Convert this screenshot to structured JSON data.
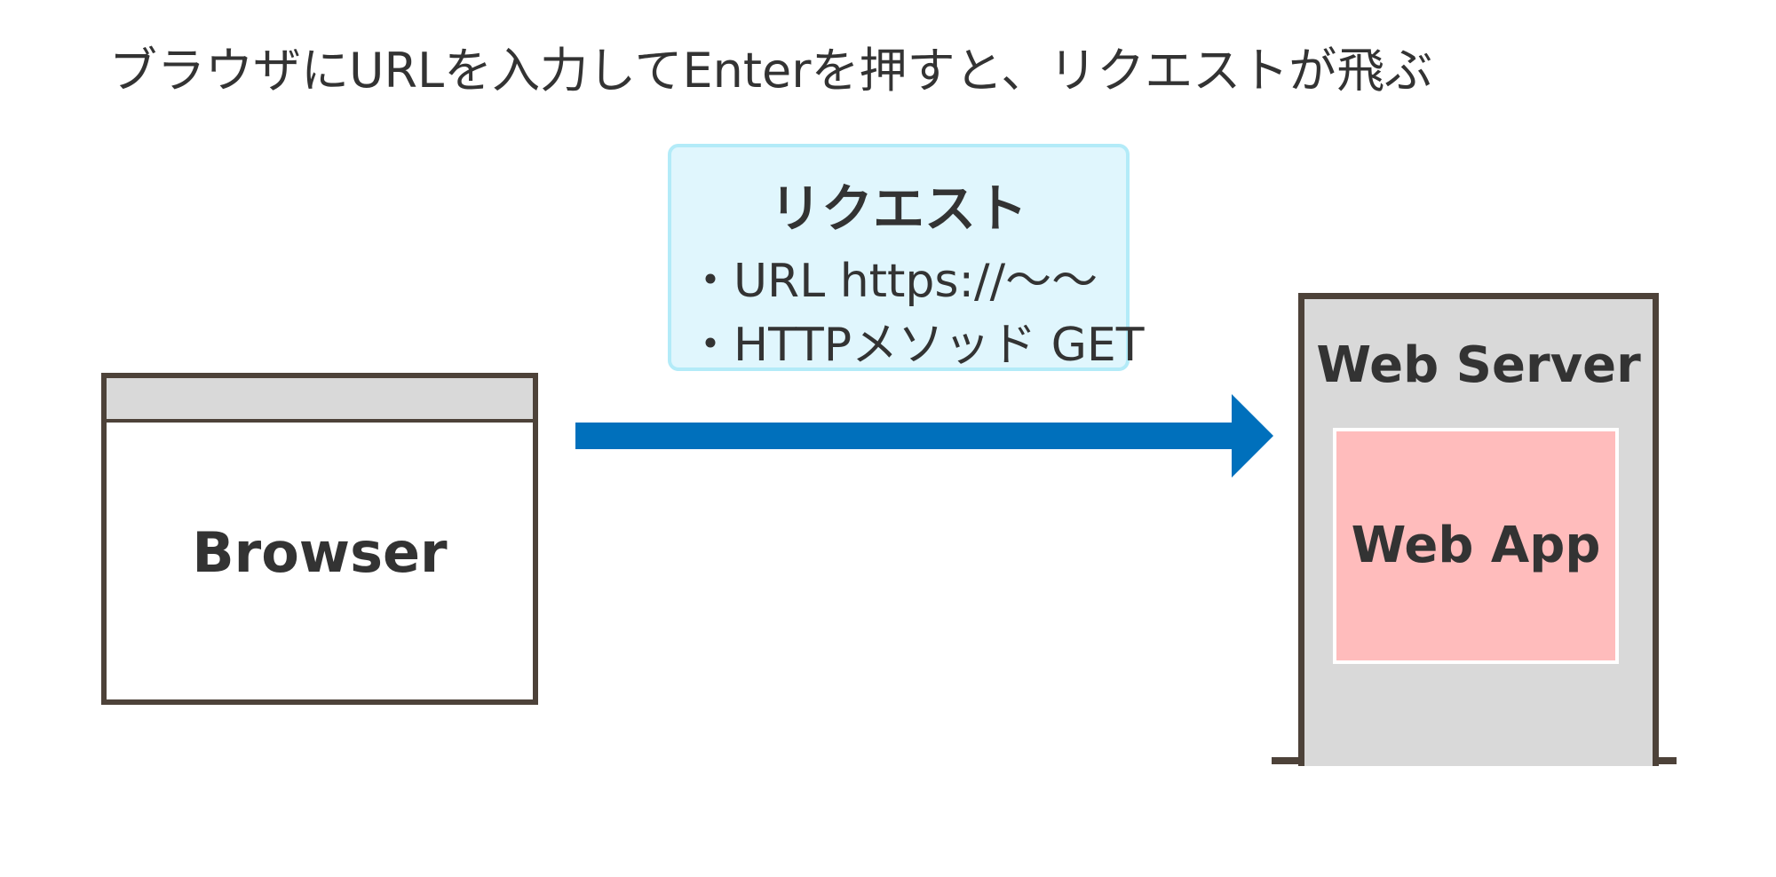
{
  "title": "ブラウザにURLを入力してEnterを押すと、リクエストが飛ぶ",
  "browser": {
    "label": "Browser"
  },
  "request": {
    "title": "リクエスト",
    "lines": [
      "・URL https://〜〜",
      "・HTTPメソッド GET"
    ]
  },
  "server": {
    "label": "Web Server",
    "app_label": "Web App"
  },
  "colors": {
    "arrow": "#0070bc",
    "outline": "#4d4239",
    "server_fill": "#d9d9d9",
    "app_fill": "#ffbcbc",
    "request_fill": "#e0f6fd",
    "request_border": "#b3ebf8"
  }
}
